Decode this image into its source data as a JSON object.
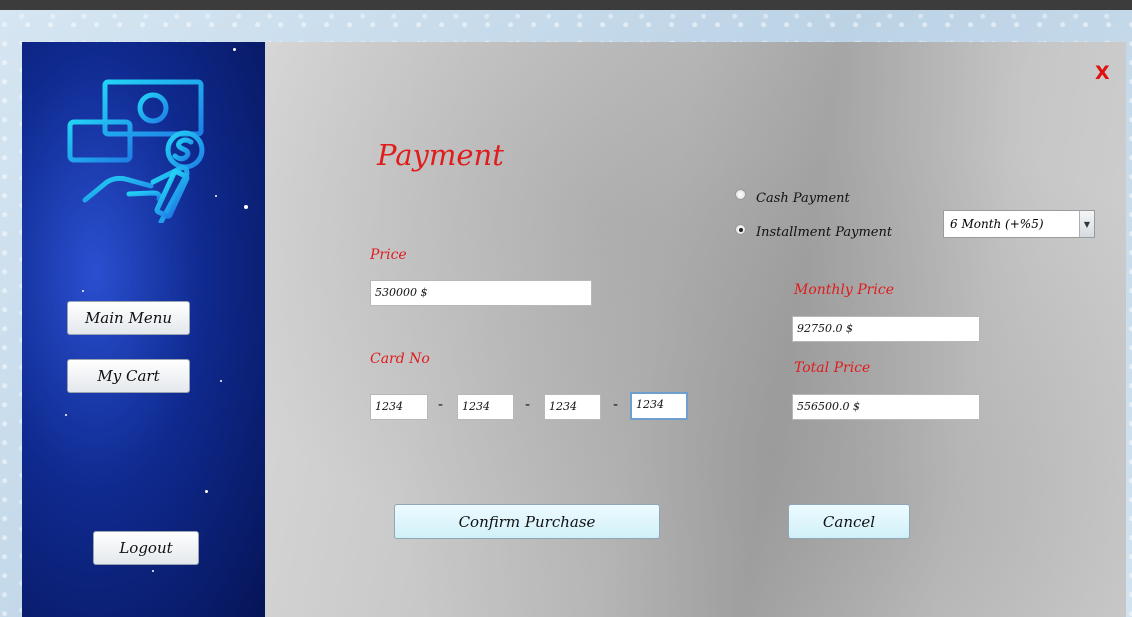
{
  "window": {
    "close_label": "X"
  },
  "sidebar": {
    "main_menu_label": "Main Menu",
    "my_cart_label": "My Cart",
    "logout_label": "Logout"
  },
  "payment": {
    "title": "Payment",
    "price_label": "Price",
    "price_value": "530000 $",
    "card_label": "Card No",
    "card_parts": [
      "1234",
      "1234",
      "1234",
      "1234"
    ],
    "card_separator": "-",
    "cash_label": "Cash Payment",
    "installment_label": "Installment Payment",
    "selected_method": "installment",
    "installment_option": "6 Month (+%5)",
    "monthly_label": "Monthly Price",
    "monthly_value": "92750.0 $",
    "total_label": "Total Price",
    "total_value": "556500.0 $",
    "confirm_label": "Confirm Purchase",
    "cancel_label": "Cancel"
  },
  "colors": {
    "accent_red": "#e01c1c",
    "sidebar_blue": "#0f2a8f",
    "logo_cyan": "#1ec8f0"
  },
  "icons": {
    "logo": "money-hand-icon",
    "dropdown": "chevron-down-icon"
  }
}
